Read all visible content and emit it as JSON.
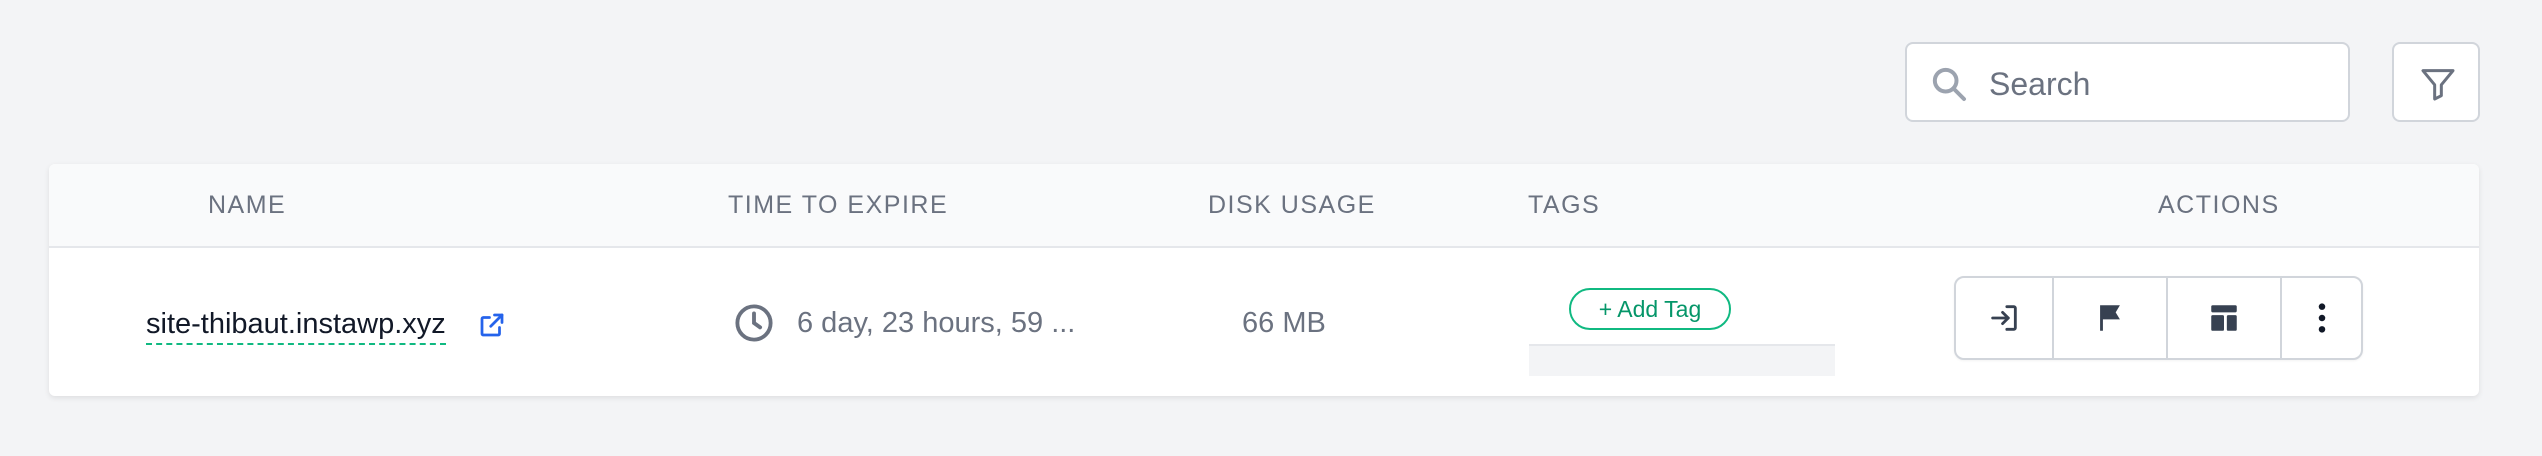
{
  "toolbar": {
    "search_placeholder": "Search",
    "search_value": "",
    "search_icon": "search-icon",
    "filter_icon": "filter-icon"
  },
  "table": {
    "headers": {
      "name": "NAME",
      "time_to_expire": "TIME TO EXPIRE",
      "disk_usage": "DISK USAGE",
      "tags": "TAGS",
      "actions": "ACTIONS"
    },
    "rows": [
      {
        "name": "site-thibaut.instawp.xyz",
        "time_to_expire": "6 day, 23 hours, 59 ...",
        "disk_usage": "66 MB",
        "add_tag_label": "+ Add Tag",
        "actions": [
          "login-icon",
          "flag-icon",
          "layout-icon",
          "more-vertical-icon"
        ]
      }
    ]
  },
  "colors": {
    "accent_green": "#10b981",
    "link_blue": "#2563eb",
    "text_muted": "#6b7280",
    "icon_dark": "#374151",
    "background": "#f3f4f6"
  }
}
